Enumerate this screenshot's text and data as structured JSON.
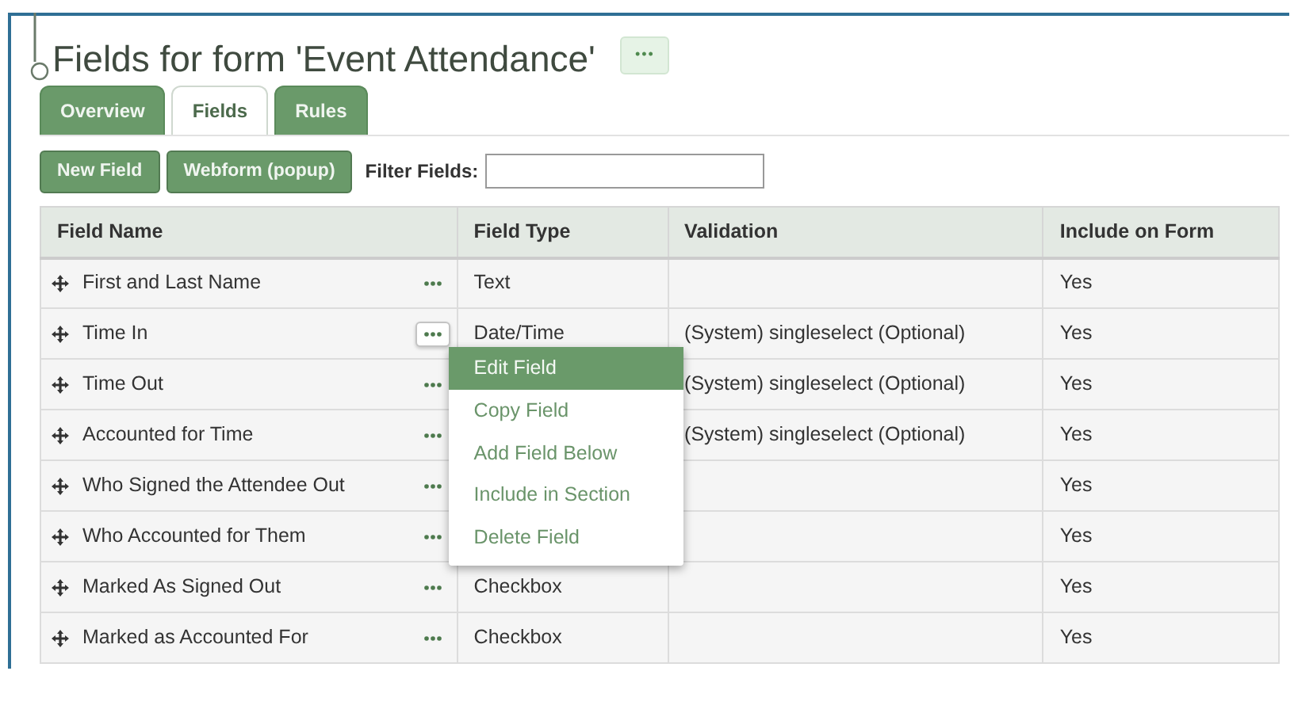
{
  "title": "Fields for form 'Event Attendance'",
  "title_menu": {
    "label": "•••"
  },
  "tabs": [
    {
      "label": "Overview",
      "selected": false
    },
    {
      "label": "Fields",
      "selected": true
    },
    {
      "label": "Rules",
      "selected": false
    }
  ],
  "toolbar": {
    "buttons": [
      "New Field",
      "Webform (popup)"
    ],
    "filter_label": "Filter Fields:"
  },
  "table": {
    "columns": [
      "Field Name",
      "Field Type",
      "Validation",
      "Include on Form"
    ],
    "rows": [
      {
        "field_name": "First and Last Name",
        "field_type": "Text",
        "include": "Yes",
        "menu_open": false
      },
      {
        "field_name": "Time In",
        "field_type": "Date/Time",
        "validation": "(System) singleselect (Optional)",
        "include": "Yes",
        "menu_open": true
      },
      {
        "field_name": "Time Out",
        "validation": "(System) singleselect (Optional)",
        "include": "Yes",
        "menu_open": false
      },
      {
        "field_name": "Accounted for Time",
        "validation": "(System) singleselect (Optional)",
        "include": "Yes",
        "menu_open": false
      },
      {
        "field_name": "Who Signed the Attendee Out",
        "include": "Yes",
        "menu_open": false
      },
      {
        "field_name": "Who Accounted for Them",
        "include": "Yes",
        "menu_open": false
      },
      {
        "field_name": "Marked As Signed Out",
        "field_type": "Checkbox",
        "include": "Yes",
        "menu_open": false
      },
      {
        "field_name": "Marked as Accounted For",
        "field_type": "Checkbox",
        "include": "Yes",
        "menu_open": false
      }
    ]
  },
  "row_menu": {
    "items": [
      {
        "label": "Edit Field",
        "selected": true
      },
      {
        "label": "Copy Field",
        "selected": false
      },
      {
        "label": "Add Field Below",
        "selected": false
      },
      {
        "label": "Include in Section",
        "selected": false
      },
      {
        "label": "Delete Field",
        "selected": false
      }
    ]
  }
}
